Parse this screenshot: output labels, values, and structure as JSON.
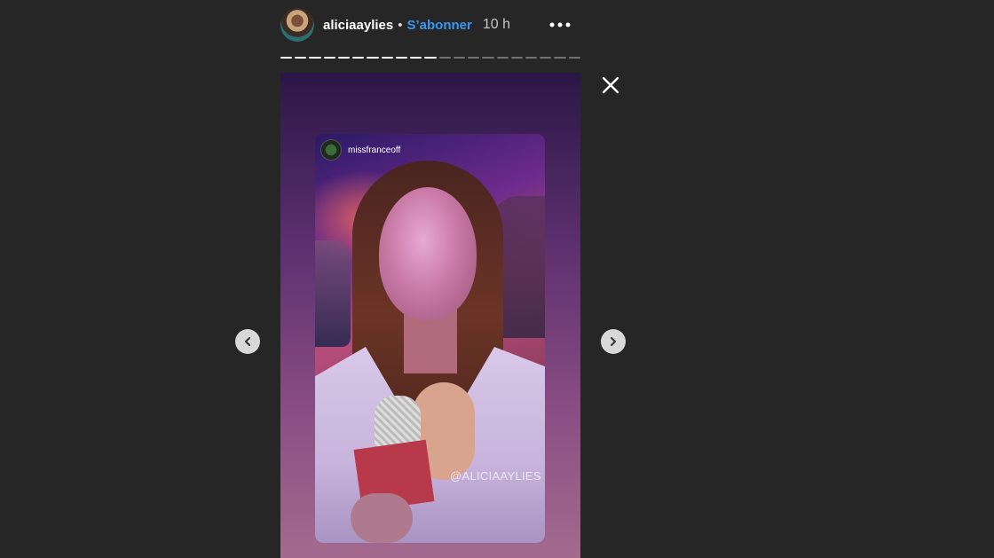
{
  "header": {
    "username": "aliciaaylies",
    "separator": "•",
    "follow_label": "S’abonner",
    "time": "10 h"
  },
  "story": {
    "progress": {
      "total_segments": 21,
      "completed_segments": 11
    },
    "repost": {
      "username": "missfranceoff",
      "mention": "@ALICIAAYLIES"
    }
  },
  "icons": {
    "more": "more-horizontal-icon",
    "close": "close-icon",
    "prev": "chevron-left-icon",
    "next": "chevron-right-icon"
  },
  "colors": {
    "background": "#262626",
    "follow": "#3897f0",
    "nav_button": "#d8d8d8"
  }
}
